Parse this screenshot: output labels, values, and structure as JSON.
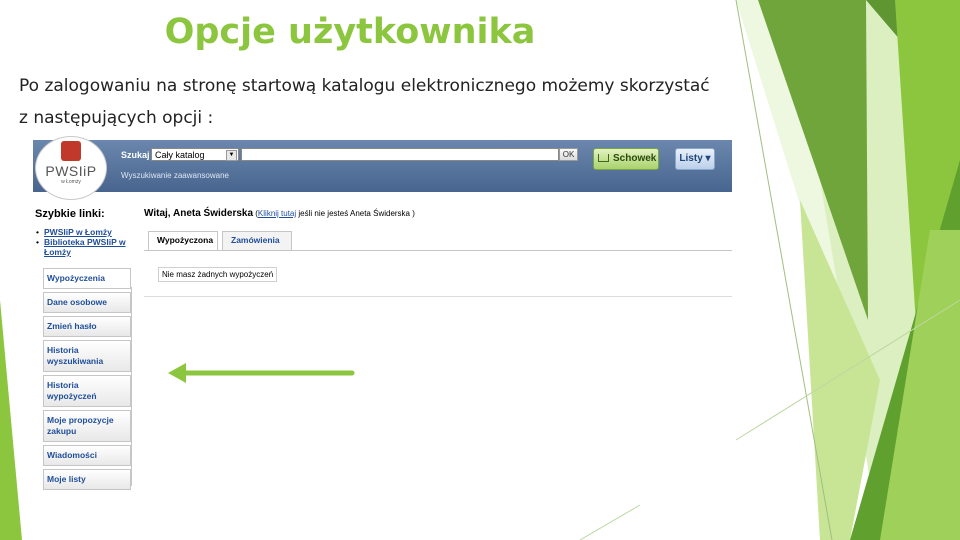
{
  "slide": {
    "title": "Opcje użytkownika",
    "body_line1": "Po zalogowaniu na stronę startową katalogu elektronicznego możemy skorzystać",
    "body_line2": "z następujących opcji :",
    "accent_color": "#8cc63f"
  },
  "catalog": {
    "logo_text": "PWSIiP",
    "logo_subtext": "w Łomży",
    "search": {
      "label": "Szukaj",
      "scope_value": "Cały katalog",
      "query_value": "",
      "ok_label": "OK",
      "advanced_link": "Wyszukiwanie zaawansowane"
    },
    "toolbar": {
      "schowek_label": "Schowek",
      "listy_label": "Listy ▾"
    },
    "quick_links": {
      "title": "Szybkie linki:",
      "items": [
        "PWSIiP w Łomży",
        "Biblioteka PWSIiP w Łomży"
      ]
    },
    "side_menu": [
      "Wypożyczenia",
      "Dane osobowe",
      "Zmień hasło",
      "Historia wyszukiwania",
      "Historia wypożyczeń",
      "Moje propozycje zakupu",
      "Wiadomości",
      "Moje listy"
    ],
    "greeting": {
      "prefix": "Witaj, Aneta Świderska",
      "paren_open": " (",
      "link": "Kliknij tutaj",
      "suffix": " jeśli nie jesteś Aneta Świderska )"
    },
    "tabs": [
      "Wypożyczona",
      "Zamówienia"
    ],
    "empty_message": "Nie masz żadnych wypożyczeń"
  }
}
